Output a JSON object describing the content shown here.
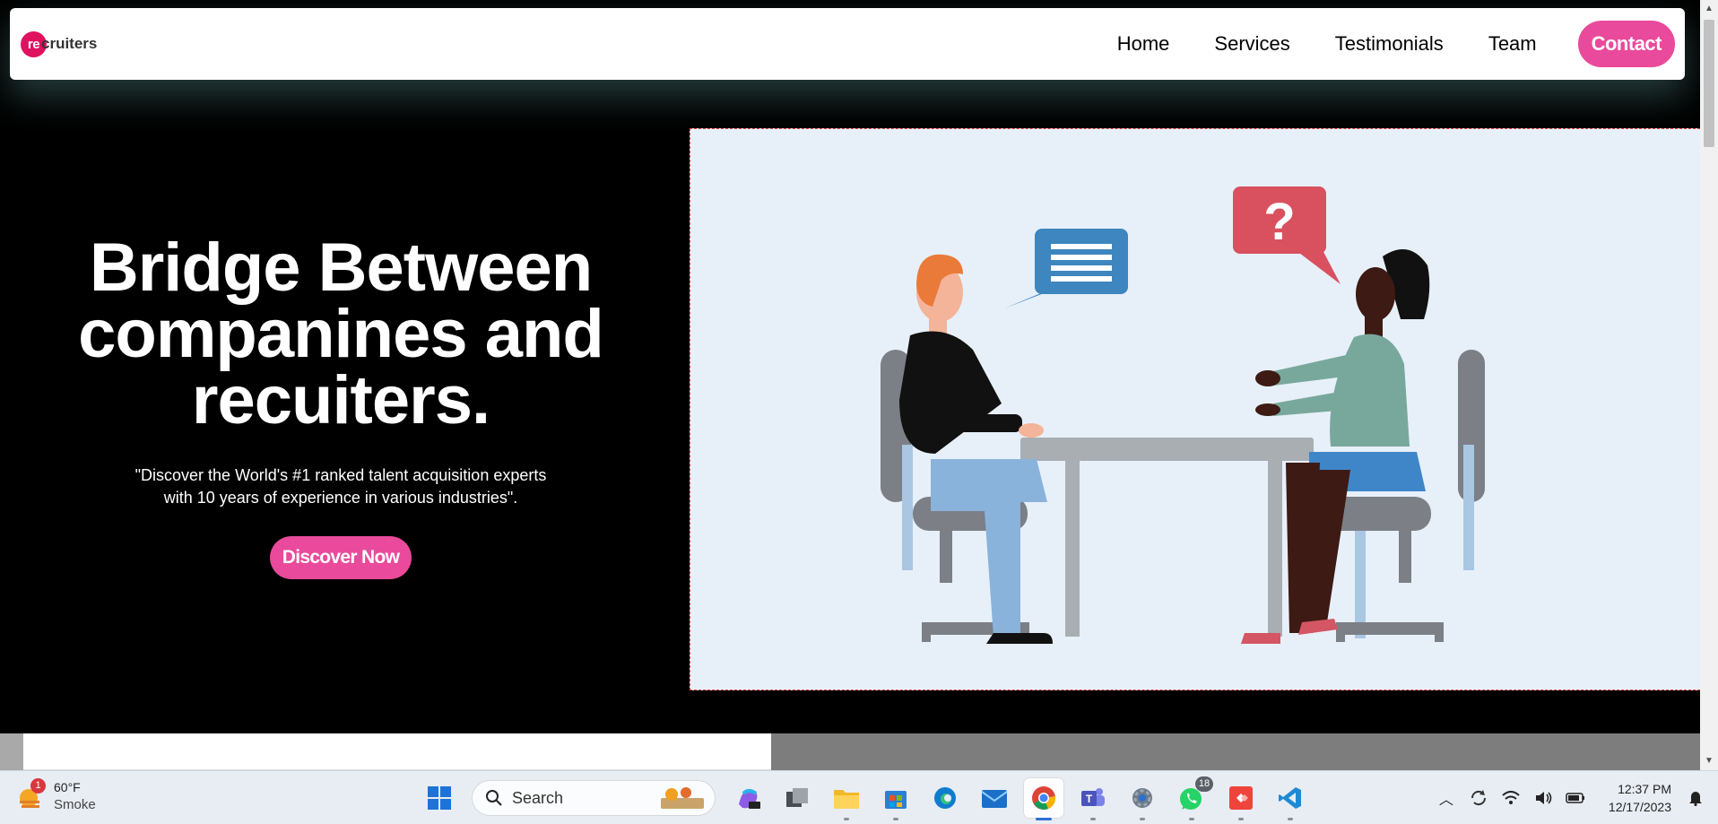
{
  "navbar": {
    "logo_mark": "re",
    "logo_rest": "cruiters",
    "links": [
      "Home",
      "Services",
      "Testimonials",
      "Team"
    ],
    "contact_label": "Contact",
    "accent_color": "#e94a9b"
  },
  "hero": {
    "title_line1": "Bridge Between",
    "title_line2": "companines and",
    "title_line3": "recuiters.",
    "subtitle_line1": "\"Discover the World's #1 ranked talent acquisition experts",
    "subtitle_line2": "with 10 years of experience in various industries\".",
    "cta_label": "Discover Now",
    "illustration": "interview-illustration"
  },
  "taskbar": {
    "weather": {
      "temp": "60°F",
      "condition": "Smoke",
      "badge": "1"
    },
    "search_placeholder": "Search",
    "apps": [
      "windows-start-icon",
      "copilot-icon",
      "task-view-icon",
      "file-explorer-icon",
      "microsoft-store-icon",
      "edge-icon",
      "mail-icon",
      "chrome-icon",
      "teams-icon",
      "settings-icon",
      "whatsapp-icon",
      "anydesk-icon",
      "vscode-icon"
    ],
    "whatsapp_badge": "18",
    "clock": {
      "time": "12:37 PM",
      "date": "12/17/2023"
    }
  }
}
